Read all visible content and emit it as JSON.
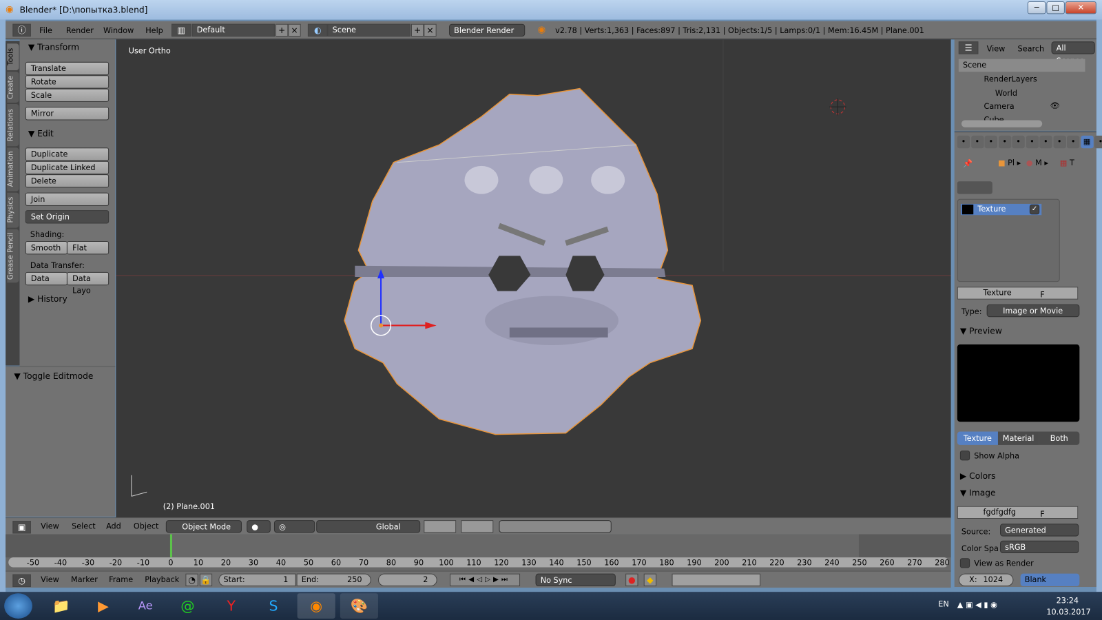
{
  "window": {
    "title": "Blender* [D:\\попытка3.blend]",
    "min": "─",
    "max": "□",
    "close": "✕"
  },
  "info": {
    "menus": [
      "File",
      "Render",
      "Window",
      "Help"
    ],
    "layout": "Default",
    "scene": "Scene",
    "engine": "Blender Render",
    "stats": "v2.78 | Verts:1,363 | Faces:897 | Tris:2,131 | Objects:1/5 | Lamps:0/1 | Mem:16.45M | Plane.001"
  },
  "tool_tabs": [
    "Tools",
    "Create",
    "Relations",
    "Animation",
    "Physics",
    "Grease Pencil"
  ],
  "tools": {
    "transform": "Transform",
    "translate": "Translate",
    "rotate": "Rotate",
    "scale": "Scale",
    "mirror": "Mirror",
    "edit": "Edit",
    "duplicate": "Duplicate",
    "duplicate_linked": "Duplicate Linked",
    "delete": "Delete",
    "join": "Join",
    "set_origin": "Set Origin",
    "shading": "Shading:",
    "smooth": "Smooth",
    "flat": "Flat",
    "data_transfer": "Data Transfer:",
    "data": "Data",
    "data_layo": "Data Layo",
    "history": "History",
    "toggle_editmode": "Toggle Editmode"
  },
  "viewport": {
    "label": "User Ortho",
    "object_label": "(2) Plane.001",
    "colors": {
      "mesh": "#a6a6bf",
      "outline": "#e8953a"
    }
  },
  "view_header": {
    "menus": [
      "View",
      "Select",
      "Add",
      "Object"
    ],
    "mode": "Object Mode",
    "orientation": "Global"
  },
  "timeline": {
    "ticks": [
      "-50",
      "-40",
      "-30",
      "-20",
      "-10",
      "0",
      "10",
      "20",
      "30",
      "40",
      "50",
      "60",
      "70",
      "80",
      "90",
      "100",
      "110",
      "120",
      "130",
      "140",
      "150",
      "160",
      "170",
      "180",
      "190",
      "200",
      "210",
      "220",
      "230",
      "240",
      "250",
      "260",
      "270",
      "280"
    ],
    "current_frame": 2,
    "menus": [
      "View",
      "Marker",
      "Frame",
      "Playback"
    ],
    "start_label": "Start:",
    "start": "1",
    "end_label": "End:",
    "end": "250",
    "frame": "2",
    "sync": "No Sync"
  },
  "outliner": {
    "view": "View",
    "search": "Search",
    "filter": "All Scenes",
    "items": [
      "Scene",
      "RenderLayers",
      "World",
      "Camera",
      "Cube"
    ]
  },
  "properties": {
    "breadcrumb": [
      "Pl",
      "M",
      "T"
    ],
    "slot_selected": "Texture",
    "texture_name": "Texture",
    "f": "F",
    "type_label": "Type:",
    "type": "Image or Movie",
    "preview": "Preview",
    "preview_tabs": [
      "Texture",
      "Material",
      "Both"
    ],
    "show_alpha": "Show Alpha",
    "colors": "Colors",
    "image": "Image",
    "image_name": "fgdfgdfg",
    "source_label": "Source:",
    "source": "Generated",
    "colorspace_label": "Color Spa",
    "colorspace": "sRGB",
    "view_as_render": "View as Render",
    "x_label": "X:",
    "x": "1024",
    "blank": "Blank"
  },
  "taskbar": {
    "lang": "EN",
    "time": "23:24",
    "date": "10.03.2017"
  }
}
